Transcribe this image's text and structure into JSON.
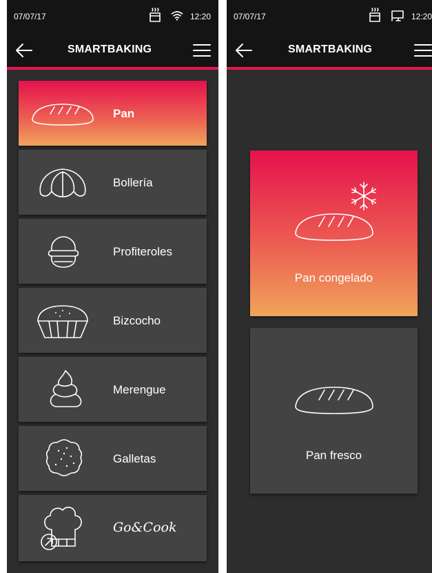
{
  "left_screen": {
    "status": {
      "date": "07/07/17",
      "time": "12:20"
    },
    "app_title": "SMARTBAKING",
    "menu": [
      {
        "label": "Pan",
        "icon": "bread-icon",
        "active": true
      },
      {
        "label": "Bollería",
        "icon": "croissant-icon",
        "active": false
      },
      {
        "label": "Profiteroles",
        "icon": "profiterole-icon",
        "active": false
      },
      {
        "label": "Bizcocho",
        "icon": "cake-icon",
        "active": false
      },
      {
        "label": "Merengue",
        "icon": "meringue-icon",
        "active": false
      },
      {
        "label": "Galletas",
        "icon": "cookie-icon",
        "active": false
      },
      {
        "label": "Go&Cook",
        "icon": "chef-hat-icon",
        "active": false
      }
    ]
  },
  "right_screen": {
    "status": {
      "date": "07/07/17",
      "time": "12:20"
    },
    "app_title": "SMARTBAKING",
    "options": [
      {
        "label": "Pan congelado",
        "icon": "frozen-bread-icon",
        "active": true
      },
      {
        "label": "Pan fresco",
        "icon": "bread-icon",
        "active": false
      }
    ]
  },
  "colors": {
    "accent": "#e4174e",
    "gradient_top": "#e5124d",
    "gradient_bottom": "#f0a45b",
    "background": "#2d2d2d",
    "card": "#434343",
    "bar": "#141414"
  }
}
